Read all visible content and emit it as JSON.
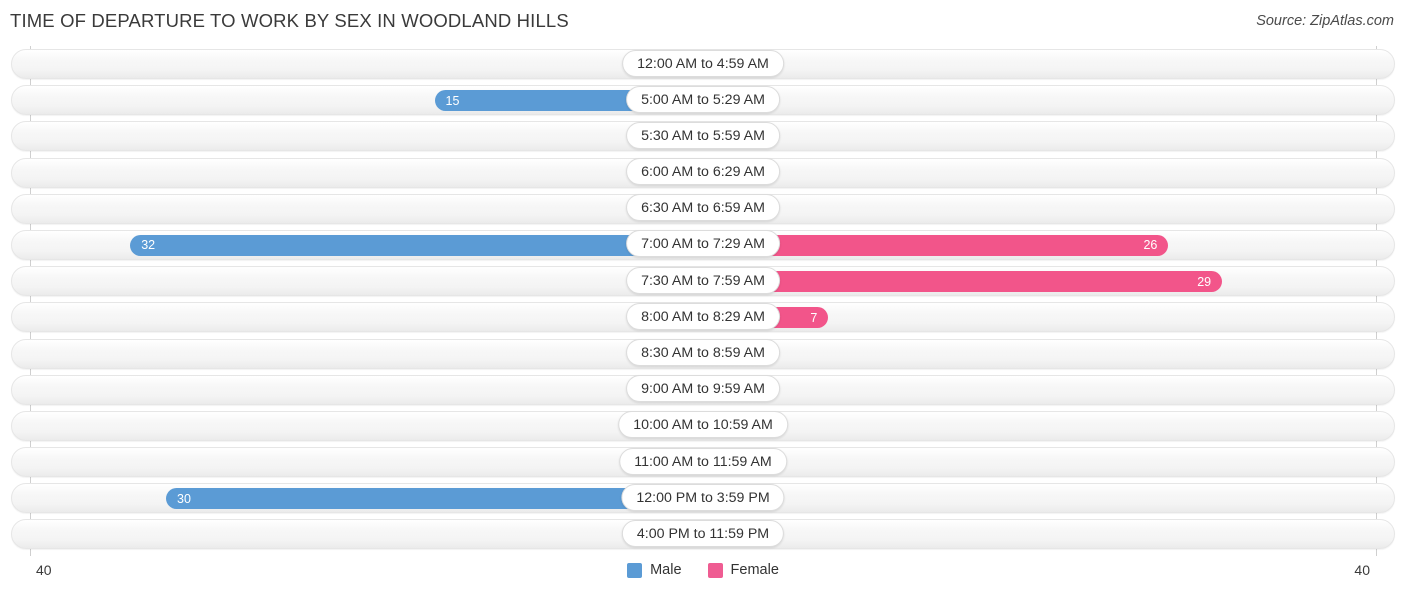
{
  "header": {
    "title": "TIME OF DEPARTURE TO WORK BY SEX IN WOODLAND HILLS",
    "source": "Source: ZipAtlas.com"
  },
  "legend": {
    "male_label": "Male",
    "female_label": "Female",
    "male_color": "#5b9bd5",
    "female_color": "#ef5c92"
  },
  "axis": {
    "left_tick": "40",
    "right_tick": "40"
  },
  "colors": {
    "male_strong": "#5b9bd5",
    "male_light": "#a8c8ec",
    "female_strong": "#f2558a",
    "female_light": "#f5a0bf",
    "track": "#f4f4f4",
    "axis_line": "#cfcfcf",
    "title_text": "#3a3a3a"
  },
  "chart_data": {
    "type": "bar",
    "subtype": "diverging-bidirectional",
    "title": "TIME OF DEPARTURE TO WORK BY SEX IN WOODLAND HILLS",
    "xlabel": "",
    "ylabel": "",
    "xlim": [
      40,
      40
    ],
    "axis_max": 40,
    "grid": false,
    "legend_position": "bottom-center",
    "categories": [
      "12:00 AM to 4:59 AM",
      "5:00 AM to 5:29 AM",
      "5:30 AM to 5:59 AM",
      "6:00 AM to 6:29 AM",
      "6:30 AM to 6:59 AM",
      "7:00 AM to 7:29 AM",
      "7:30 AM to 7:59 AM",
      "8:00 AM to 8:29 AM",
      "8:30 AM to 8:59 AM",
      "9:00 AM to 9:59 AM",
      "10:00 AM to 10:59 AM",
      "11:00 AM to 11:59 AM",
      "12:00 PM to 3:59 PM",
      "4:00 PM to 11:59 PM"
    ],
    "series": [
      {
        "name": "Male",
        "direction": "left",
        "color": "#5b9bd5",
        "values": [
          0,
          15,
          0,
          0,
          0,
          32,
          0,
          0,
          0,
          0,
          0,
          0,
          30,
          0
        ]
      },
      {
        "name": "Female",
        "direction": "right",
        "color": "#f2558a",
        "values": [
          0,
          0,
          0,
          0,
          0,
          26,
          29,
          7,
          0,
          0,
          0,
          0,
          0,
          0
        ]
      }
    ]
  },
  "rows": [
    {
      "category": "12:00 AM to 4:59 AM",
      "male": "0",
      "female": "0"
    },
    {
      "category": "5:00 AM to 5:29 AM",
      "male": "15",
      "female": "0"
    },
    {
      "category": "5:30 AM to 5:59 AM",
      "male": "0",
      "female": "0"
    },
    {
      "category": "6:00 AM to 6:29 AM",
      "male": "0",
      "female": "0"
    },
    {
      "category": "6:30 AM to 6:59 AM",
      "male": "0",
      "female": "0"
    },
    {
      "category": "7:00 AM to 7:29 AM",
      "male": "32",
      "female": "26"
    },
    {
      "category": "7:30 AM to 7:59 AM",
      "male": "0",
      "female": "29"
    },
    {
      "category": "8:00 AM to 8:29 AM",
      "male": "0",
      "female": "7"
    },
    {
      "category": "8:30 AM to 8:59 AM",
      "male": "0",
      "female": "0"
    },
    {
      "category": "9:00 AM to 9:59 AM",
      "male": "0",
      "female": "0"
    },
    {
      "category": "10:00 AM to 10:59 AM",
      "male": "0",
      "female": "0"
    },
    {
      "category": "11:00 AM to 11:59 AM",
      "male": "0",
      "female": "0"
    },
    {
      "category": "12:00 PM to 3:59 PM",
      "male": "30",
      "female": "0"
    },
    {
      "category": "4:00 PM to 11:59 PM",
      "male": "0",
      "female": "0"
    }
  ]
}
